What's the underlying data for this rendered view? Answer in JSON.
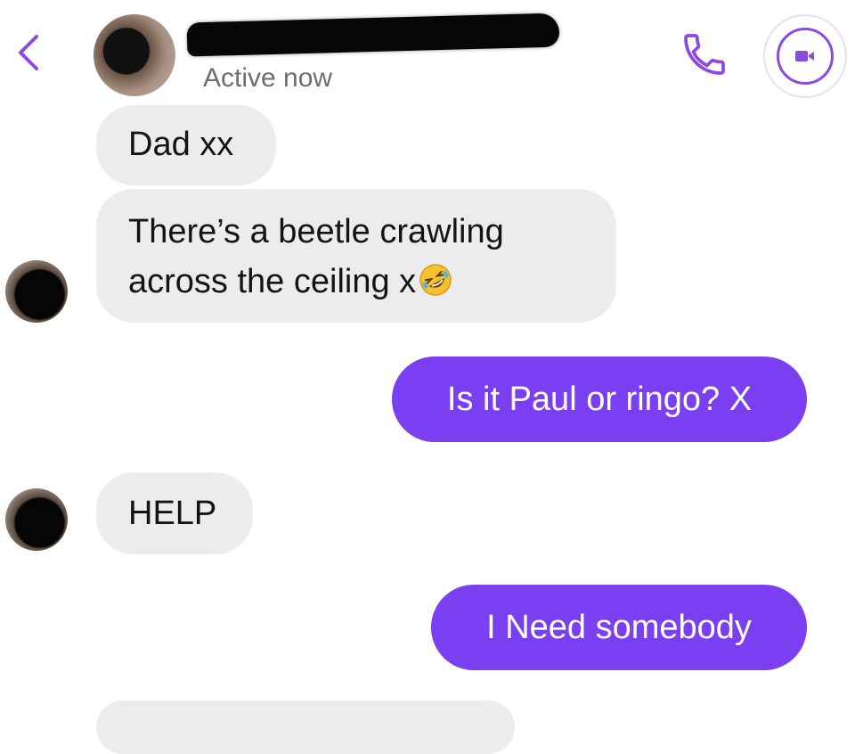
{
  "header": {
    "status": "Active now",
    "icons": {
      "back": "chevron-left-icon",
      "call": "phone-icon",
      "video": "video-camera-icon"
    }
  },
  "messages": [
    {
      "direction": "incoming",
      "text": "Dad xx"
    },
    {
      "direction": "incoming",
      "lines": [
        "There’s a beetle crawling",
        "across the ceiling x"
      ],
      "emoji": "rolling-on-floor-laughing-emoji"
    },
    {
      "direction": "outgoing",
      "text": "Is it Paul or ringo? X"
    },
    {
      "direction": "incoming",
      "text": "HELP"
    },
    {
      "direction": "outgoing",
      "text": "I Need somebody"
    }
  ],
  "colors": {
    "accent": "#7a3ff0",
    "incoming_bubble": "#ececec",
    "status_text": "#6d6d6d"
  }
}
